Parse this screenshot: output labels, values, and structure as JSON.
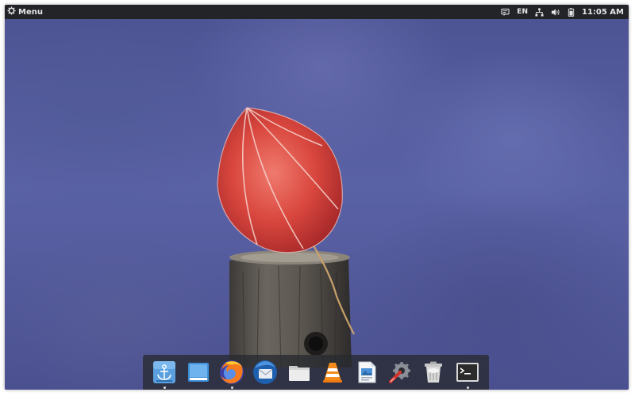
{
  "panel": {
    "menu_label": "Menu",
    "language": "EN",
    "clock": "11:05 AM"
  },
  "dock": {
    "apps": [
      {
        "icon": "anchor-dock-icon"
      },
      {
        "icon": "desktop-window-icon"
      },
      {
        "icon": "firefox-icon"
      },
      {
        "icon": "thunderbird-icon"
      },
      {
        "icon": "file-manager-icon"
      },
      {
        "icon": "vlc-icon"
      },
      {
        "icon": "document-viewer-icon"
      },
      {
        "icon": "settings-tools-icon"
      },
      {
        "icon": "trash-icon"
      },
      {
        "icon": "terminal-icon"
      }
    ]
  },
  "colors": {
    "panel_bg": "#222428",
    "wallpaper_blue": "#5a62a6",
    "leaf_red": "#d9473e"
  }
}
